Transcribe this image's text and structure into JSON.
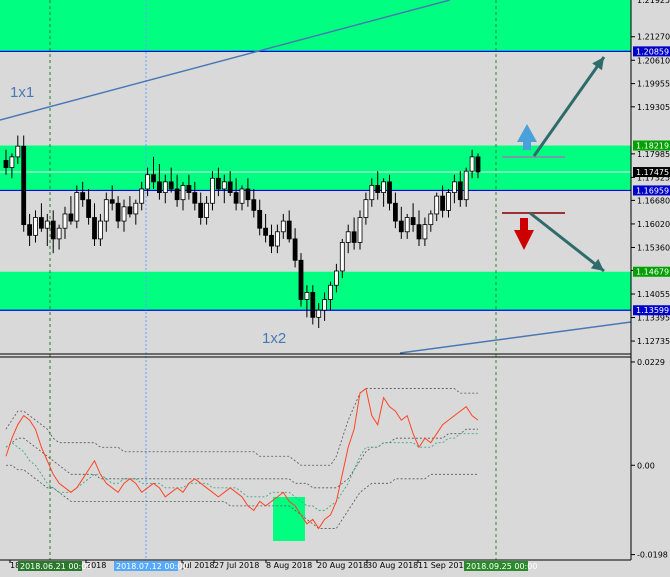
{
  "chart_data": {
    "type": "candlestick",
    "instrument_chart": {
      "price_ticks": [
        "1.21270",
        "1.20610",
        "1.19955",
        "1.19305",
        "1.17985",
        "1.17325",
        "1.16680",
        "1.16020",
        "1.15360",
        "1.14715",
        "1.14055",
        "1.13395",
        "1.12735"
      ],
      "top_tick_partial": "1.21925",
      "price_range": [
        1.124,
        1.223
      ],
      "price_tags": [
        {
          "value": 1.20859,
          "label": "1.20859",
          "color": "#0000c8"
        },
        {
          "value": 1.18219,
          "label": "1.18219",
          "color": "#00a000"
        },
        {
          "value": 1.17475,
          "label": "1.17475",
          "color": "#000000"
        },
        {
          "value": 1.16959,
          "label": "1.16959",
          "color": "#0000c8"
        },
        {
          "value": 1.14679,
          "label": "1.14679",
          "color": "#00a000"
        },
        {
          "value": 1.13599,
          "label": "1.13599",
          "color": "#0000c8"
        }
      ],
      "zones": [
        {
          "from": 1.20859,
          "to": 1.224
        },
        {
          "from": 1.16959,
          "to": 1.18219
        },
        {
          "from": 1.13599,
          "to": 1.14679
        }
      ],
      "annotations": [
        {
          "text": "1x1",
          "price": 1.1962,
          "bar": 2
        },
        {
          "text": "1x2",
          "price": 1.1338,
          "bar": 62
        }
      ],
      "candles": [
        {
          "o": 1.178,
          "h": 1.181,
          "l": 1.174,
          "c": 1.176
        },
        {
          "o": 1.176,
          "h": 1.18,
          "l": 1.173,
          "c": 1.179
        },
        {
          "o": 1.179,
          "h": 1.185,
          "l": 1.177,
          "c": 1.182
        },
        {
          "o": 1.182,
          "h": 1.185,
          "l": 1.158,
          "c": 1.16
        },
        {
          "o": 1.16,
          "h": 1.163,
          "l": 1.154,
          "c": 1.157
        },
        {
          "o": 1.157,
          "h": 1.164,
          "l": 1.155,
          "c": 1.162
        },
        {
          "o": 1.162,
          "h": 1.166,
          "l": 1.158,
          "c": 1.159
        },
        {
          "o": 1.159,
          "h": 1.163,
          "l": 1.154,
          "c": 1.161
        },
        {
          "o": 1.161,
          "h": 1.164,
          "l": 1.152,
          "c": 1.156
        },
        {
          "o": 1.156,
          "h": 1.16,
          "l": 1.153,
          "c": 1.159
        },
        {
          "o": 1.159,
          "h": 1.165,
          "l": 1.156,
          "c": 1.163
        },
        {
          "o": 1.163,
          "h": 1.168,
          "l": 1.16,
          "c": 1.161
        },
        {
          "o": 1.161,
          "h": 1.171,
          "l": 1.159,
          "c": 1.169
        },
        {
          "o": 1.169,
          "h": 1.172,
          "l": 1.165,
          "c": 1.167
        },
        {
          "o": 1.167,
          "h": 1.17,
          "l": 1.16,
          "c": 1.162
        },
        {
          "o": 1.162,
          "h": 1.166,
          "l": 1.154,
          "c": 1.156
        },
        {
          "o": 1.156,
          "h": 1.163,
          "l": 1.154,
          "c": 1.161
        },
        {
          "o": 1.161,
          "h": 1.169,
          "l": 1.158,
          "c": 1.167
        },
        {
          "o": 1.167,
          "h": 1.171,
          "l": 1.164,
          "c": 1.166
        },
        {
          "o": 1.166,
          "h": 1.168,
          "l": 1.159,
          "c": 1.161
        },
        {
          "o": 1.161,
          "h": 1.167,
          "l": 1.158,
          "c": 1.165
        },
        {
          "o": 1.165,
          "h": 1.168,
          "l": 1.162,
          "c": 1.163
        },
        {
          "o": 1.163,
          "h": 1.167,
          "l": 1.16,
          "c": 1.166
        },
        {
          "o": 1.166,
          "h": 1.172,
          "l": 1.164,
          "c": 1.17
        },
        {
          "o": 1.17,
          "h": 1.176,
          "l": 1.168,
          "c": 1.174
        },
        {
          "o": 1.174,
          "h": 1.179,
          "l": 1.17,
          "c": 1.172
        },
        {
          "o": 1.172,
          "h": 1.177,
          "l": 1.167,
          "c": 1.169
        },
        {
          "o": 1.169,
          "h": 1.174,
          "l": 1.166,
          "c": 1.172
        },
        {
          "o": 1.172,
          "h": 1.176,
          "l": 1.169,
          "c": 1.17
        },
        {
          "o": 1.17,
          "h": 1.174,
          "l": 1.165,
          "c": 1.167
        },
        {
          "o": 1.167,
          "h": 1.172,
          "l": 1.164,
          "c": 1.171
        },
        {
          "o": 1.171,
          "h": 1.174,
          "l": 1.167,
          "c": 1.169
        },
        {
          "o": 1.169,
          "h": 1.172,
          "l": 1.164,
          "c": 1.166
        },
        {
          "o": 1.166,
          "h": 1.169,
          "l": 1.16,
          "c": 1.162
        },
        {
          "o": 1.162,
          "h": 1.168,
          "l": 1.16,
          "c": 1.166
        },
        {
          "o": 1.166,
          "h": 1.175,
          "l": 1.164,
          "c": 1.173
        },
        {
          "o": 1.173,
          "h": 1.176,
          "l": 1.168,
          "c": 1.17
        },
        {
          "o": 1.17,
          "h": 1.174,
          "l": 1.166,
          "c": 1.172
        },
        {
          "o": 1.172,
          "h": 1.175,
          "l": 1.168,
          "c": 1.169
        },
        {
          "o": 1.169,
          "h": 1.173,
          "l": 1.164,
          "c": 1.166
        },
        {
          "o": 1.166,
          "h": 1.171,
          "l": 1.164,
          "c": 1.17
        },
        {
          "o": 1.17,
          "h": 1.173,
          "l": 1.165,
          "c": 1.167
        },
        {
          "o": 1.167,
          "h": 1.17,
          "l": 1.162,
          "c": 1.164
        },
        {
          "o": 1.164,
          "h": 1.167,
          "l": 1.157,
          "c": 1.159
        },
        {
          "o": 1.159,
          "h": 1.163,
          "l": 1.155,
          "c": 1.157
        },
        {
          "o": 1.157,
          "h": 1.16,
          "l": 1.152,
          "c": 1.154
        },
        {
          "o": 1.154,
          "h": 1.16,
          "l": 1.152,
          "c": 1.158
        },
        {
          "o": 1.158,
          "h": 1.163,
          "l": 1.156,
          "c": 1.161
        },
        {
          "o": 1.161,
          "h": 1.164,
          "l": 1.155,
          "c": 1.156
        },
        {
          "o": 1.156,
          "h": 1.159,
          "l": 1.148,
          "c": 1.15
        },
        {
          "o": 1.15,
          "h": 1.152,
          "l": 1.137,
          "c": 1.139
        },
        {
          "o": 1.139,
          "h": 1.143,
          "l": 1.134,
          "c": 1.141
        },
        {
          "o": 1.141,
          "h": 1.143,
          "l": 1.132,
          "c": 1.134
        },
        {
          "o": 1.134,
          "h": 1.138,
          "l": 1.131,
          "c": 1.136
        },
        {
          "o": 1.136,
          "h": 1.141,
          "l": 1.133,
          "c": 1.139
        },
        {
          "o": 1.139,
          "h": 1.144,
          "l": 1.136,
          "c": 1.143
        },
        {
          "o": 1.143,
          "h": 1.149,
          "l": 1.141,
          "c": 1.147
        },
        {
          "o": 1.147,
          "h": 1.156,
          "l": 1.145,
          "c": 1.155
        },
        {
          "o": 1.155,
          "h": 1.16,
          "l": 1.152,
          "c": 1.158
        },
        {
          "o": 1.158,
          "h": 1.162,
          "l": 1.153,
          "c": 1.155
        },
        {
          "o": 1.155,
          "h": 1.164,
          "l": 1.153,
          "c": 1.162
        },
        {
          "o": 1.162,
          "h": 1.169,
          "l": 1.16,
          "c": 1.167
        },
        {
          "o": 1.167,
          "h": 1.173,
          "l": 1.165,
          "c": 1.171
        },
        {
          "o": 1.171,
          "h": 1.175,
          "l": 1.167,
          "c": 1.169
        },
        {
          "o": 1.169,
          "h": 1.173,
          "l": 1.165,
          "c": 1.172
        },
        {
          "o": 1.172,
          "h": 1.174,
          "l": 1.164,
          "c": 1.166
        },
        {
          "o": 1.166,
          "h": 1.169,
          "l": 1.159,
          "c": 1.161
        },
        {
          "o": 1.161,
          "h": 1.165,
          "l": 1.156,
          "c": 1.158
        },
        {
          "o": 1.158,
          "h": 1.163,
          "l": 1.156,
          "c": 1.162
        },
        {
          "o": 1.162,
          "h": 1.166,
          "l": 1.158,
          "c": 1.16
        },
        {
          "o": 1.16,
          "h": 1.164,
          "l": 1.154,
          "c": 1.156
        },
        {
          "o": 1.156,
          "h": 1.162,
          "l": 1.154,
          "c": 1.16
        },
        {
          "o": 1.16,
          "h": 1.164,
          "l": 1.158,
          "c": 1.163
        },
        {
          "o": 1.163,
          "h": 1.169,
          "l": 1.161,
          "c": 1.168
        },
        {
          "o": 1.168,
          "h": 1.171,
          "l": 1.162,
          "c": 1.164
        },
        {
          "o": 1.164,
          "h": 1.17,
          "l": 1.162,
          "c": 1.169
        },
        {
          "o": 1.169,
          "h": 1.174,
          "l": 1.166,
          "c": 1.172
        },
        {
          "o": 1.172,
          "h": 1.175,
          "l": 1.165,
          "c": 1.167
        },
        {
          "o": 1.167,
          "h": 1.176,
          "l": 1.165,
          "c": 1.175
        },
        {
          "o": 1.175,
          "h": 1.181,
          "l": 1.173,
          "c": 1.179
        },
        {
          "o": 1.179,
          "h": 1.18,
          "l": 1.173,
          "c": 1.1748
        }
      ]
    },
    "indicator": {
      "ticks": [
        "0.0229",
        "0.00",
        "-0.0198"
      ],
      "range": [
        -0.021,
        0.024
      ],
      "main_line": [
        0.002,
        0.006,
        0.009,
        0.011,
        0.01,
        0.008,
        0.004,
        0.001,
        -0.002,
        -0.004,
        -0.005,
        -0.006,
        -0.005,
        -0.003,
        -0.001,
        0.001,
        -0.002,
        -0.004,
        -0.005,
        -0.006,
        -0.004,
        -0.003,
        -0.004,
        -0.006,
        -0.005,
        -0.004,
        -0.005,
        -0.007,
        -0.006,
        -0.005,
        -0.006,
        -0.004,
        -0.003,
        -0.004,
        -0.005,
        -0.006,
        -0.007,
        -0.006,
        -0.005,
        -0.006,
        -0.007,
        -0.009,
        -0.01,
        -0.008,
        -0.009,
        -0.008,
        -0.007,
        -0.006,
        -0.008,
        -0.009,
        -0.011,
        -0.013,
        -0.012,
        -0.014,
        -0.012,
        -0.011,
        -0.008,
        -0.002,
        0.004,
        0.008,
        0.016,
        0.017,
        0.011,
        0.009,
        0.015,
        0.013,
        0.012,
        0.01,
        0.011,
        0.007,
        0.004,
        0.006,
        0.005,
        0.007,
        0.009,
        0.01,
        0.011,
        0.012,
        0.013,
        0.011,
        0.01
      ],
      "signal_line": [
        0.004,
        0.005,
        0.006,
        0.006,
        0.005,
        0.004,
        0.003,
        0.002,
        0.001,
        0.0,
        -0.001,
        -0.002,
        -0.002,
        -0.002,
        -0.002,
        -0.002,
        -0.003,
        -0.003,
        -0.003,
        -0.003,
        -0.003,
        -0.003,
        -0.003,
        -0.003,
        -0.003,
        -0.003,
        -0.003,
        -0.003,
        -0.003,
        -0.003,
        -0.003,
        -0.003,
        -0.003,
        -0.003,
        -0.003,
        -0.003,
        -0.003,
        -0.003,
        -0.003,
        -0.003,
        -0.003,
        -0.003,
        -0.003,
        -0.003,
        -0.003,
        -0.003,
        -0.003,
        -0.003,
        -0.003,
        -0.004,
        -0.004,
        -0.004,
        -0.005,
        -0.005,
        -0.005,
        -0.005,
        -0.005,
        -0.004,
        -0.003,
        -0.001,
        0.001,
        0.003,
        0.004,
        0.004,
        0.005,
        0.005,
        0.006,
        0.006,
        0.006,
        0.006,
        0.006,
        0.006,
        0.006,
        0.006,
        0.006,
        0.007,
        0.007,
        0.007,
        0.008,
        0.008,
        0.008
      ],
      "upper_band": [
        0.008,
        0.01,
        0.012,
        0.012,
        0.011,
        0.01,
        0.009,
        0.008,
        0.006,
        0.005,
        0.005,
        0.005,
        0.005,
        0.005,
        0.005,
        0.005,
        0.004,
        0.004,
        0.004,
        0.004,
        0.003,
        0.003,
        0.003,
        0.003,
        0.003,
        0.003,
        0.003,
        0.003,
        0.003,
        0.003,
        0.003,
        0.003,
        0.003,
        0.003,
        0.003,
        0.003,
        0.003,
        0.003,
        0.003,
        0.003,
        0.003,
        0.003,
        0.003,
        0.002,
        0.002,
        0.002,
        0.002,
        0.002,
        0.002,
        0.001,
        0.0,
        0.0,
        0.0,
        0.0,
        0.0,
        0.0,
        0.002,
        0.006,
        0.01,
        0.013,
        0.016,
        0.017,
        0.017,
        0.017,
        0.017,
        0.017,
        0.017,
        0.017,
        0.017,
        0.017,
        0.017,
        0.017,
        0.017,
        0.017,
        0.017,
        0.017,
        0.017,
        0.016,
        0.016,
        0.016,
        0.016
      ],
      "lower_band": [
        0.0,
        0.0,
        -0.001,
        -0.001,
        -0.002,
        -0.003,
        -0.004,
        -0.005,
        -0.005,
        -0.006,
        -0.007,
        -0.008,
        -0.008,
        -0.008,
        -0.008,
        -0.008,
        -0.008,
        -0.008,
        -0.008,
        -0.008,
        -0.008,
        -0.008,
        -0.008,
        -0.008,
        -0.008,
        -0.008,
        -0.008,
        -0.008,
        -0.008,
        -0.008,
        -0.008,
        -0.008,
        -0.008,
        -0.008,
        -0.008,
        -0.008,
        -0.008,
        -0.008,
        -0.009,
        -0.009,
        -0.009,
        -0.009,
        -0.009,
        -0.009,
        -0.009,
        -0.009,
        -0.009,
        -0.009,
        -0.009,
        -0.01,
        -0.011,
        -0.012,
        -0.013,
        -0.014,
        -0.014,
        -0.014,
        -0.014,
        -0.012,
        -0.01,
        -0.008,
        -0.006,
        -0.005,
        -0.004,
        -0.004,
        -0.004,
        -0.004,
        -0.003,
        -0.003,
        -0.003,
        -0.003,
        -0.003,
        -0.003,
        -0.002,
        -0.002,
        -0.002,
        -0.002,
        -0.002,
        -0.002,
        -0.002,
        -0.002,
        -0.002
      ],
      "second_line": [
        0.004,
        0.005,
        0.004,
        0.003,
        0.001,
        0.0,
        -0.002,
        -0.004,
        -0.005,
        -0.006,
        -0.006,
        -0.006,
        -0.005,
        -0.004,
        -0.003,
        -0.002,
        -0.002,
        -0.003,
        -0.004,
        -0.004,
        -0.003,
        -0.003,
        -0.003,
        -0.004,
        -0.004,
        -0.004,
        -0.004,
        -0.005,
        -0.005,
        -0.005,
        -0.005,
        -0.004,
        -0.004,
        -0.004,
        -0.004,
        -0.005,
        -0.005,
        -0.005,
        -0.005,
        -0.005,
        -0.006,
        -0.007,
        -0.007,
        -0.007,
        -0.007,
        -0.006,
        -0.006,
        -0.006,
        -0.006,
        -0.007,
        -0.008,
        -0.009,
        -0.009,
        -0.01,
        -0.01,
        -0.009,
        -0.008,
        -0.006,
        -0.004,
        -0.001,
        0.002,
        0.004,
        0.004,
        0.004,
        0.005,
        0.005,
        0.005,
        0.005,
        0.005,
        0.005,
        0.004,
        0.004,
        0.004,
        0.005,
        0.005,
        0.006,
        0.006,
        0.007,
        0.007,
        0.007,
        0.007
      ],
      "highlight": {
        "from_bar": 57,
        "to_bar": 63
      },
      "colors": {
        "main": "#ff4422",
        "second": "#3aaa88",
        "bands": "#555555"
      }
    },
    "date_labels": [
      {
        "text": "18",
        "bar": 1
      },
      {
        "text": "2018",
        "bar": 19
      },
      {
        "text": "Jul 2018",
        "bar": 39
      },
      {
        "text": "27 Jul 2018",
        "bar": 48
      },
      {
        "text": "8 Aug 2018",
        "bar": 58
      },
      {
        "text": "20 Aug 2018",
        "bar": 67
      },
      {
        "text": "30 Aug 2018",
        "bar": 76
      },
      {
        "text": "11 Sep 2018",
        "bar": 86
      }
    ],
    "date_tags": [
      {
        "text": "2018.06.21 00:00",
        "bar": 5
      },
      {
        "text": "2018.07.12 00:00",
        "bar": 26
      },
      {
        "text": "2018.09.25 00:00",
        "bar": 100
      }
    ],
    "vlines": [
      {
        "bar": 12,
        "color": "#2b7a2b",
        "style": "dash"
      },
      {
        "bar": 33,
        "color": "#55aaff",
        "style": "dot"
      },
      {
        "bar": 112,
        "color": "#2b8a2b",
        "style": "dash"
      }
    ],
    "colors": {
      "zone": "#00ff80",
      "zone_line": "#0000ff",
      "up_arrow": "#4aa0d8",
      "down_arrow": "#cc0000",
      "projection_arrow": "#2e6b6b",
      "trendline": "#4a78b5",
      "background": "#d9d9d9"
    }
  }
}
